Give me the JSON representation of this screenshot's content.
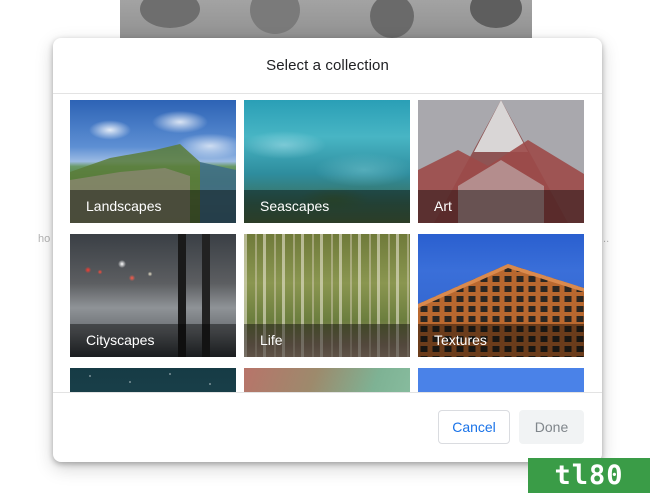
{
  "background": {
    "left_fragment": "ho",
    "right_fragment": "..."
  },
  "dialog": {
    "title": "Select a collection",
    "collections": [
      {
        "label": "Landscapes"
      },
      {
        "label": "Seascapes"
      },
      {
        "label": "Art"
      },
      {
        "label": "Cityscapes"
      },
      {
        "label": "Life"
      },
      {
        "label": "Textures"
      },
      {
        "label": ""
      },
      {
        "label": ""
      },
      {
        "label": ""
      }
    ],
    "cancel_label": "Cancel",
    "done_label": "Done"
  },
  "watermark": "tl80",
  "colors": {
    "accent": "#1a73e8",
    "done_disabled_bg": "#f1f3f4",
    "done_disabled_text": "#80868b",
    "watermark_bg": "#3a9c47"
  }
}
